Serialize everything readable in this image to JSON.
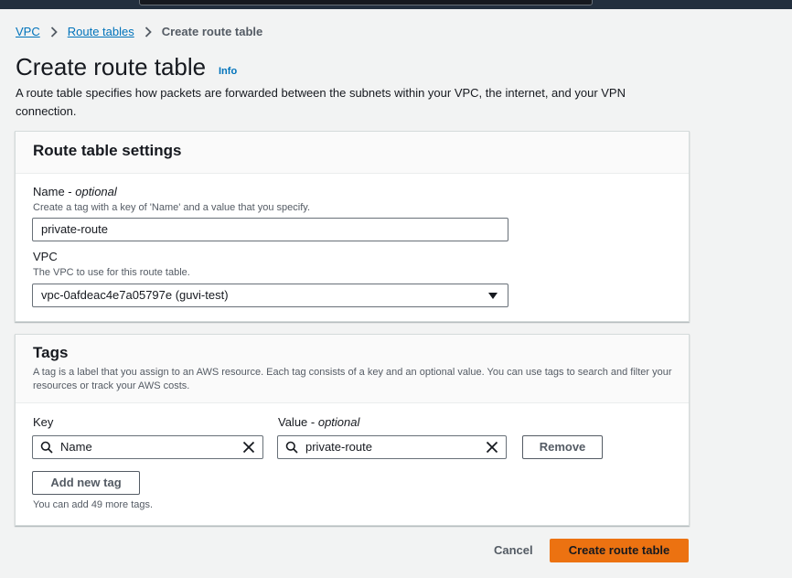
{
  "breadcrumb": {
    "items": [
      "VPC",
      "Route tables"
    ],
    "current": "Create route table"
  },
  "header": {
    "title": "Create route table",
    "info": "Info",
    "description": "A route table specifies how packets are forwarded between the subnets within your VPC, the internet, and your VPN connection."
  },
  "settings": {
    "title": "Route table settings",
    "name_label": "Name - ",
    "name_optional": "optional",
    "name_desc": "Create a tag with a key of 'Name' and a value that you specify.",
    "name_value": "private-route",
    "vpc_label": "VPC",
    "vpc_desc": "The VPC to use for this route table.",
    "vpc_value": "vpc-0afdeac4e7a05797e (guvi-test)"
  },
  "tags": {
    "title": "Tags",
    "desc": "A tag is a label that you assign to an AWS resource. Each tag consists of a key and an optional value. You can use tags to search and filter your resources or track your AWS costs.",
    "key_header": "Key",
    "value_header": "Value - ",
    "value_optional": "optional",
    "rows": [
      {
        "key": "Name",
        "value": "private-route",
        "remove_label": "Remove"
      }
    ],
    "add_label": "Add new tag",
    "limit_note": "You can add 49 more tags."
  },
  "footer": {
    "cancel": "Cancel",
    "submit": "Create route table"
  },
  "colors": {
    "primary": "#ec7211",
    "link": "#0073bb",
    "text": "#16191f"
  }
}
